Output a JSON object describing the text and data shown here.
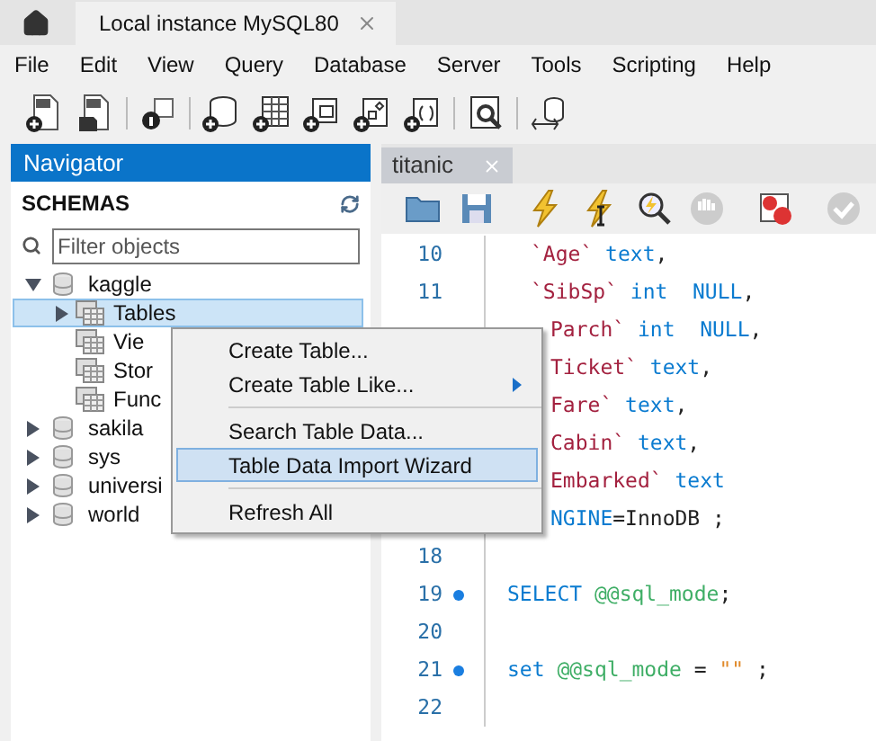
{
  "app_tabs": [
    {
      "kind": "home",
      "selected": false
    },
    {
      "kind": "connection",
      "label": "Local instance MySQL80",
      "selected": true
    }
  ],
  "menu": [
    "File",
    "Edit",
    "View",
    "Query",
    "Database",
    "Server",
    "Tools",
    "Scripting",
    "Help"
  ],
  "navigator": {
    "title": "Navigator",
    "section": "SCHEMAS",
    "filter": {
      "placeholder": "Filter objects"
    },
    "tree": [
      {
        "label": "kaggle",
        "expanded": true,
        "selected": false,
        "children": [
          {
            "label": "Tables",
            "expanded": false,
            "selected": true,
            "has_children": true
          },
          {
            "label": "Vie",
            "selected": false,
            "has_children": false
          },
          {
            "label": "Stor",
            "selected": false,
            "has_children": false
          },
          {
            "label": "Func",
            "selected": false,
            "has_children": false
          }
        ]
      },
      {
        "label": "sakila",
        "expanded": false,
        "selected": false
      },
      {
        "label": "sys",
        "expanded": false,
        "selected": false
      },
      {
        "label": "universi",
        "expanded": false,
        "selected": false
      },
      {
        "label": "world",
        "expanded": false,
        "selected": false
      }
    ]
  },
  "editor": {
    "tab": "titanic",
    "lines": [
      {
        "number": "10",
        "marker": false,
        "tokens": [
          {
            "kind": "identifier",
            "text": "`Age`"
          },
          {
            "kind": "keyword",
            "text": " text"
          },
          {
            "kind": "plain",
            "text": ","
          }
        ]
      },
      {
        "number": "11",
        "marker": false,
        "tokens": [
          {
            "kind": "identifier",
            "text": "`SibSp`"
          },
          {
            "kind": "keyword",
            "text": " int  NULL"
          },
          {
            "kind": "plain",
            "text": ","
          }
        ]
      },
      {
        "tokens": [
          {
            "kind": "identifier",
            "text": "Parch`"
          },
          {
            "kind": "keyword",
            "text": " int  NULL"
          },
          {
            "kind": "plain",
            "text": ","
          }
        ]
      },
      {
        "tokens": [
          {
            "kind": "identifier",
            "text": "Ticket`"
          },
          {
            "kind": "keyword",
            "text": " text"
          },
          {
            "kind": "plain",
            "text": ","
          }
        ]
      },
      {
        "tokens": [
          {
            "kind": "identifier",
            "text": "Fare`"
          },
          {
            "kind": "keyword",
            "text": " text"
          },
          {
            "kind": "plain",
            "text": ","
          }
        ]
      },
      {
        "tokens": [
          {
            "kind": "identifier",
            "text": "Cabin`"
          },
          {
            "kind": "keyword",
            "text": " text"
          },
          {
            "kind": "plain",
            "text": ","
          }
        ]
      },
      {
        "tokens": [
          {
            "kind": "identifier",
            "text": "Embarked`"
          },
          {
            "kind": "keyword",
            "text": " text"
          }
        ]
      },
      {
        "tokens": [
          {
            "kind": "keyword",
            "text": "NGINE"
          },
          {
            "kind": "plain",
            "text": "=InnoDB ;"
          }
        ]
      },
      {
        "number": "18",
        "marker": false
      },
      {
        "number": "19",
        "marker": true,
        "tokens": [
          {
            "kind": "keyword",
            "text": "SELECT"
          },
          {
            "kind": "variable",
            "text": " @@sql_mode"
          },
          {
            "kind": "plain",
            "text": ";"
          }
        ]
      },
      {
        "number": "20",
        "marker": false
      },
      {
        "number": "21",
        "marker": true,
        "tokens": [
          {
            "kind": "keyword",
            "text": "set"
          },
          {
            "kind": "variable",
            "text": " @@sql_mode"
          },
          {
            "kind": "plain",
            "text": " = "
          },
          {
            "kind": "string",
            "text": "\"\""
          },
          {
            "kind": "plain",
            "text": " ;"
          }
        ]
      },
      {
        "number": "22",
        "marker": false
      }
    ]
  },
  "context_menu": [
    {
      "kind": "item",
      "label": "Create Table...",
      "selected": false,
      "submenu": false
    },
    {
      "kind": "item",
      "label": "Create Table Like...",
      "selected": false,
      "submenu": true
    },
    {
      "kind": "separator"
    },
    {
      "kind": "item",
      "label": "Search Table Data...",
      "selected": false,
      "submenu": false
    },
    {
      "kind": "item",
      "label": "Table Data Import Wizard",
      "selected": true,
      "submenu": false
    },
    {
      "kind": "separator"
    },
    {
      "kind": "item",
      "label": "Refresh All",
      "selected": false,
      "submenu": false
    }
  ]
}
